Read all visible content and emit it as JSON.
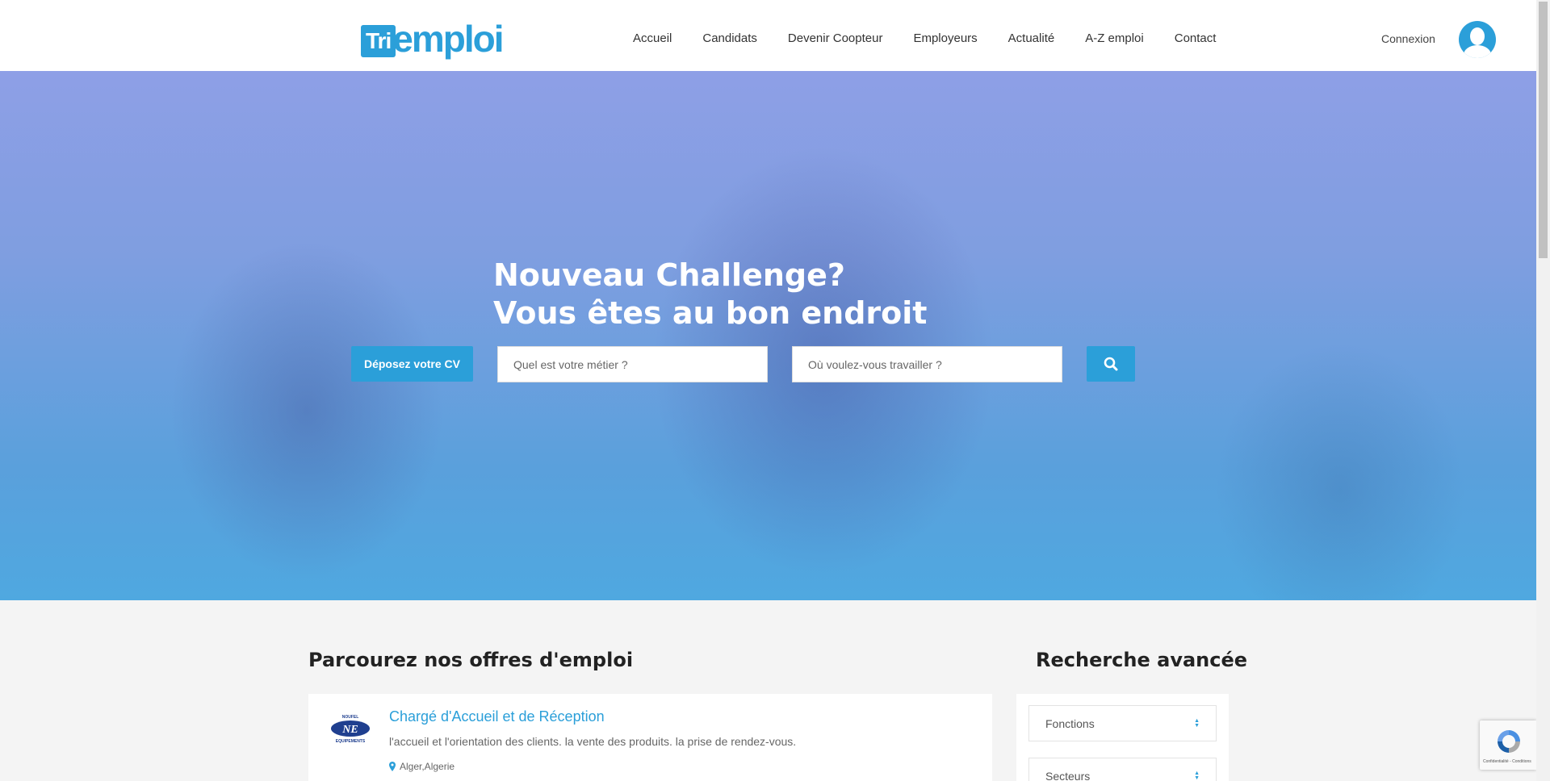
{
  "header": {
    "logo": {
      "box_text": "Tri",
      "text": "emploi"
    },
    "nav": [
      {
        "label": "Accueil"
      },
      {
        "label": "Candidats"
      },
      {
        "label": "Devenir Coopteur"
      },
      {
        "label": "Employeurs"
      },
      {
        "label": "Actualité"
      },
      {
        "label": "A-Z emploi"
      },
      {
        "label": "Contact"
      }
    ],
    "login_label": "Connexion",
    "avatar_icon": "user-icon"
  },
  "hero": {
    "title_line1": "Nouveau Challenge?",
    "title_line2": "Vous êtes au bon endroit",
    "cv_button": "Déposez votre CV",
    "job_placeholder": "Quel est votre métier ?",
    "location_placeholder": "Où voulez-vous travailler ?",
    "search_icon": "search-icon"
  },
  "offers": {
    "title": "Parcourez nos offres d'emploi",
    "jobs": [
      {
        "title": "Chargé d'Accueil et de Réception",
        "description": "l'accueil et l'orientation des clients. la vente des produits. la prise de rendez-vous.",
        "location": "Alger,Algerie",
        "company_logo_text": "NE",
        "company_logo_top": "NOUFEL",
        "company_logo_bottom": "EQUIPEMENTS"
      }
    ]
  },
  "advanced_search": {
    "title": "Recherche avancée",
    "fields": [
      {
        "label": "Fonctions"
      },
      {
        "label": "Secteurs"
      }
    ]
  },
  "recaptcha": {
    "text": "Confidentialité - Conditions"
  },
  "colors": {
    "accent": "#2b9fd9"
  }
}
